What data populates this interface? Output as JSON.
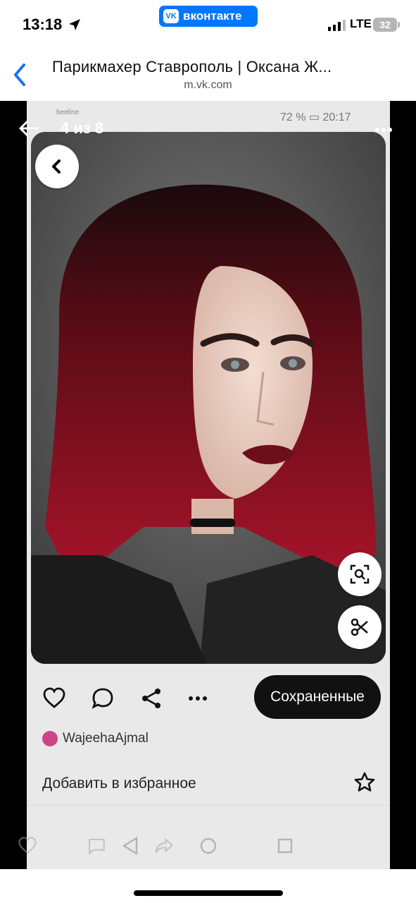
{
  "status_bar": {
    "time": "13:18",
    "network": "LTE",
    "battery": "32",
    "app_badge": "вконтакте"
  },
  "browser": {
    "title": "Парикмахер Ставрополь | Оксана Ж...",
    "url": "m.vk.com"
  },
  "viewer": {
    "counter": "4 из 8"
  },
  "screenshot": {
    "carrier": "beeline",
    "status_right": "72 % ▭ 20:17",
    "saved_button": "Сохраненные",
    "author": "WajeehaAjmal",
    "add_to_favorites": "Добавить в избранное"
  },
  "colors": {
    "vk_blue": "#0077ff",
    "ios_link_blue": "#1a73e8",
    "saved_button_bg": "#111111"
  },
  "icons": [
    "location-arrow-icon",
    "vk-logo-icon",
    "signal-icon",
    "battery-icon",
    "back-chevron-icon",
    "arrow-left-icon",
    "more-horizontal-icon",
    "heart-icon",
    "comment-icon",
    "share-icon",
    "more-icon",
    "lens-icon",
    "scissors-icon",
    "star-icon"
  ]
}
